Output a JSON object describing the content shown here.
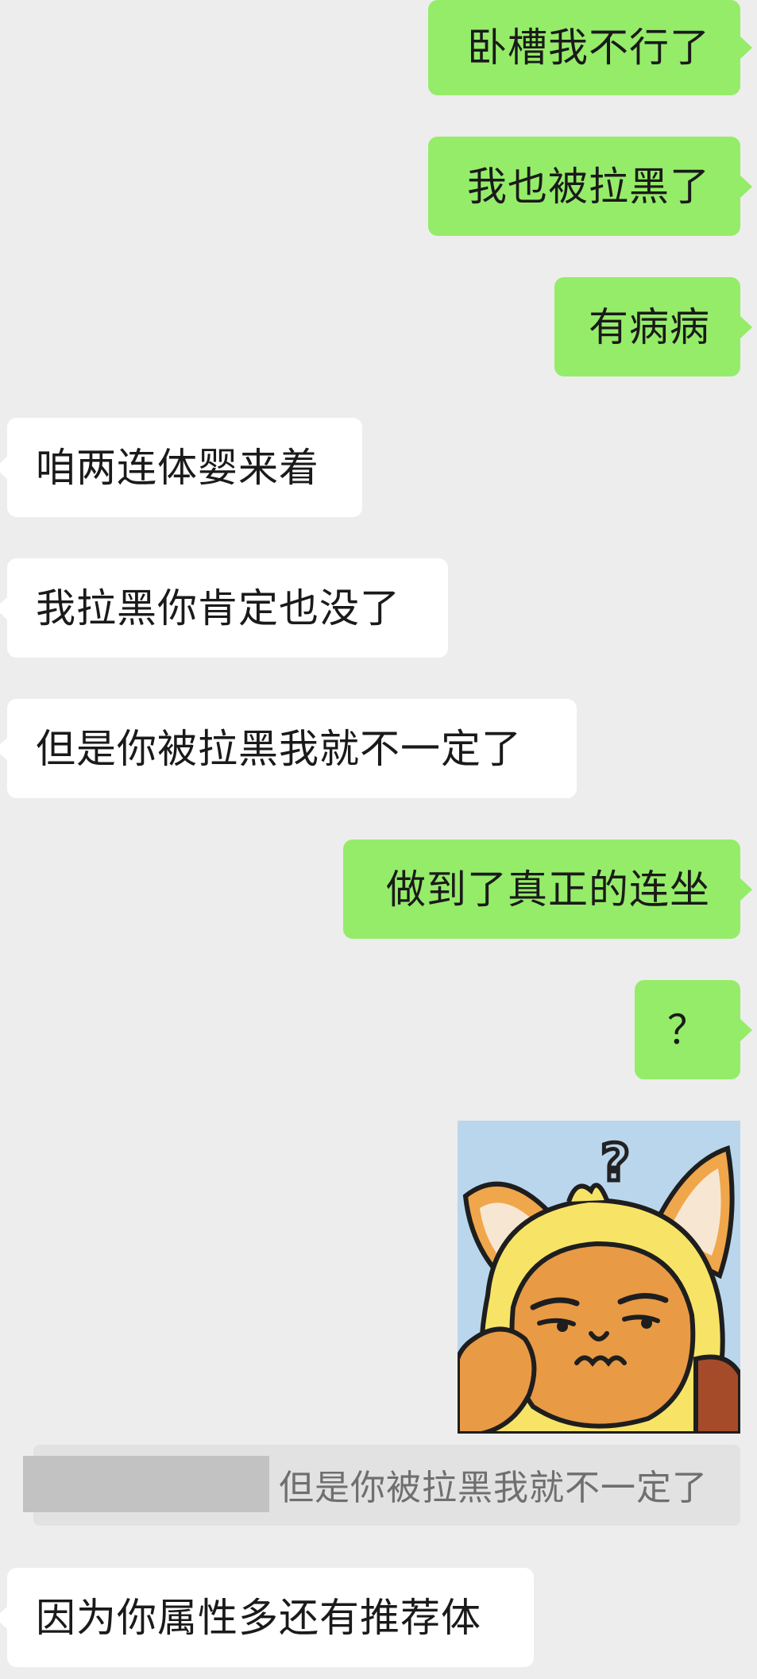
{
  "messages": [
    {
      "side": "sent",
      "text": "卧槽我不行了"
    },
    {
      "side": "sent",
      "text": "我也被拉黑了"
    },
    {
      "side": "sent",
      "text": "有病病"
    },
    {
      "side": "recv",
      "text": "咱两连体婴来着"
    },
    {
      "side": "recv",
      "text": "我拉黑你肯定也没了"
    },
    {
      "side": "recv",
      "text": "但是你被拉黑我就不一定了"
    },
    {
      "side": "sent",
      "text": "做到了真正的连坐"
    },
    {
      "side": "sent",
      "text": "？"
    },
    {
      "side": "sent",
      "type": "sticker",
      "sticker_icon": "thinking-fox-sticker-icon",
      "sticker_text": "?"
    },
    {
      "side": "recv",
      "text": "因为你属性多还有推荐体"
    }
  ],
  "quote": {
    "text": "但是你被拉黑我就不一定了"
  },
  "colors": {
    "background": "#ededed",
    "sent_bubble": "#95ec69",
    "recv_bubble": "#ffffff",
    "quote_background": "#e2e2e2",
    "quote_text": "#6f6f6f"
  }
}
